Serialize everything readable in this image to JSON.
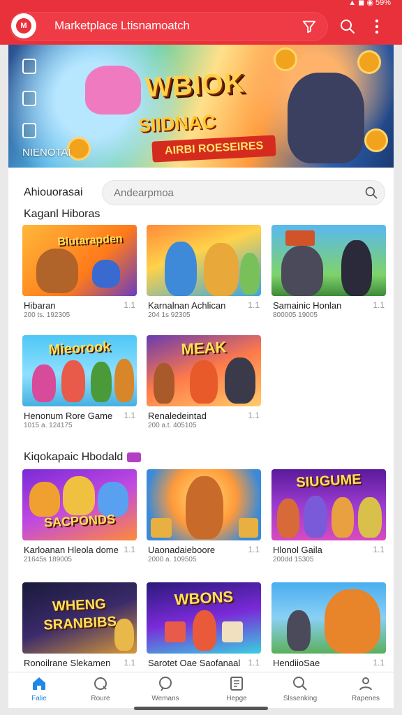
{
  "status_bar": {
    "indicators": "▲ ◼ ◉ 59%"
  },
  "app_bar": {
    "title": "Marketplace Ltisnamoatch",
    "logo_text": "M",
    "accent_color": "#e8313a",
    "icons": [
      "filter-icon",
      "search-icon",
      "more-vertical-icon"
    ]
  },
  "hero": {
    "logo_line1": "WBIOK",
    "logo_line2": "SIIDNAC",
    "ribbon": "AIRBI ROESEIRES",
    "caption": "NIENOTAI",
    "side_icons": [
      "badge-icon",
      "settings-icon",
      "bag-icon"
    ]
  },
  "filter_row": {
    "label": "Ahiouorasai",
    "placeholder": "Andearpmoa"
  },
  "groups": [
    {
      "title": "Kaganl Hiboras",
      "cards": [
        {
          "art_text": "Blutarapden",
          "title": "Hibaran",
          "meta": "200 ts.  192305",
          "count": "1.1"
        },
        {
          "art_text": "",
          "title": "Karnalnan Achlican",
          "meta": "204 1s   92305",
          "count": "1.1"
        },
        {
          "art_text": "",
          "title": "Samainic Honlan",
          "meta": "800005   19005",
          "count": "1.1"
        },
        {
          "art_text": "Mieorook",
          "title": "Henonum Rore Game",
          "meta": "1015 a.   124175",
          "count": "1.1"
        },
        {
          "art_text": "MEAK",
          "title": "Renaledeintad",
          "meta": "200 a.t.   405105",
          "count": "1.1"
        }
      ]
    },
    {
      "title": "Kiqokapaic Hbodald",
      "cards": [
        {
          "art_text": "SACPONDS",
          "title": "Karloanan Hleola dome",
          "meta": "21645s   189005",
          "count": "1.1"
        },
        {
          "art_text": "",
          "title": "Uaonadaieboore",
          "meta": "2000  a.   109505",
          "count": "1.1"
        },
        {
          "art_text": "SIUGUME",
          "title": "Hlonol Gaila",
          "meta": "200dd   15305",
          "count": "1.1"
        },
        {
          "art_text": "WHENG SRANBIBS",
          "title": "Ronoilrane Slekamen",
          "meta": "",
          "count": "1.1"
        },
        {
          "art_text": "WBONS",
          "title": "Sarotet Oae Saofanaal",
          "meta": "",
          "count": "1.1"
        },
        {
          "art_text": "",
          "title": "HendiioSae",
          "meta": "",
          "count": "1.1"
        }
      ]
    }
  ],
  "bottom_nav": [
    {
      "label": "Falie",
      "icon": "home-icon",
      "active": true
    },
    {
      "label": "Roure",
      "icon": "refresh-icon",
      "active": false
    },
    {
      "label": "Wemans",
      "icon": "chat-icon",
      "active": false
    },
    {
      "label": "Hepge",
      "icon": "page-icon",
      "active": false
    },
    {
      "label": "Slssenking",
      "icon": "search-icon",
      "active": false
    },
    {
      "label": "Rapenes",
      "icon": "profile-icon",
      "active": false
    }
  ]
}
